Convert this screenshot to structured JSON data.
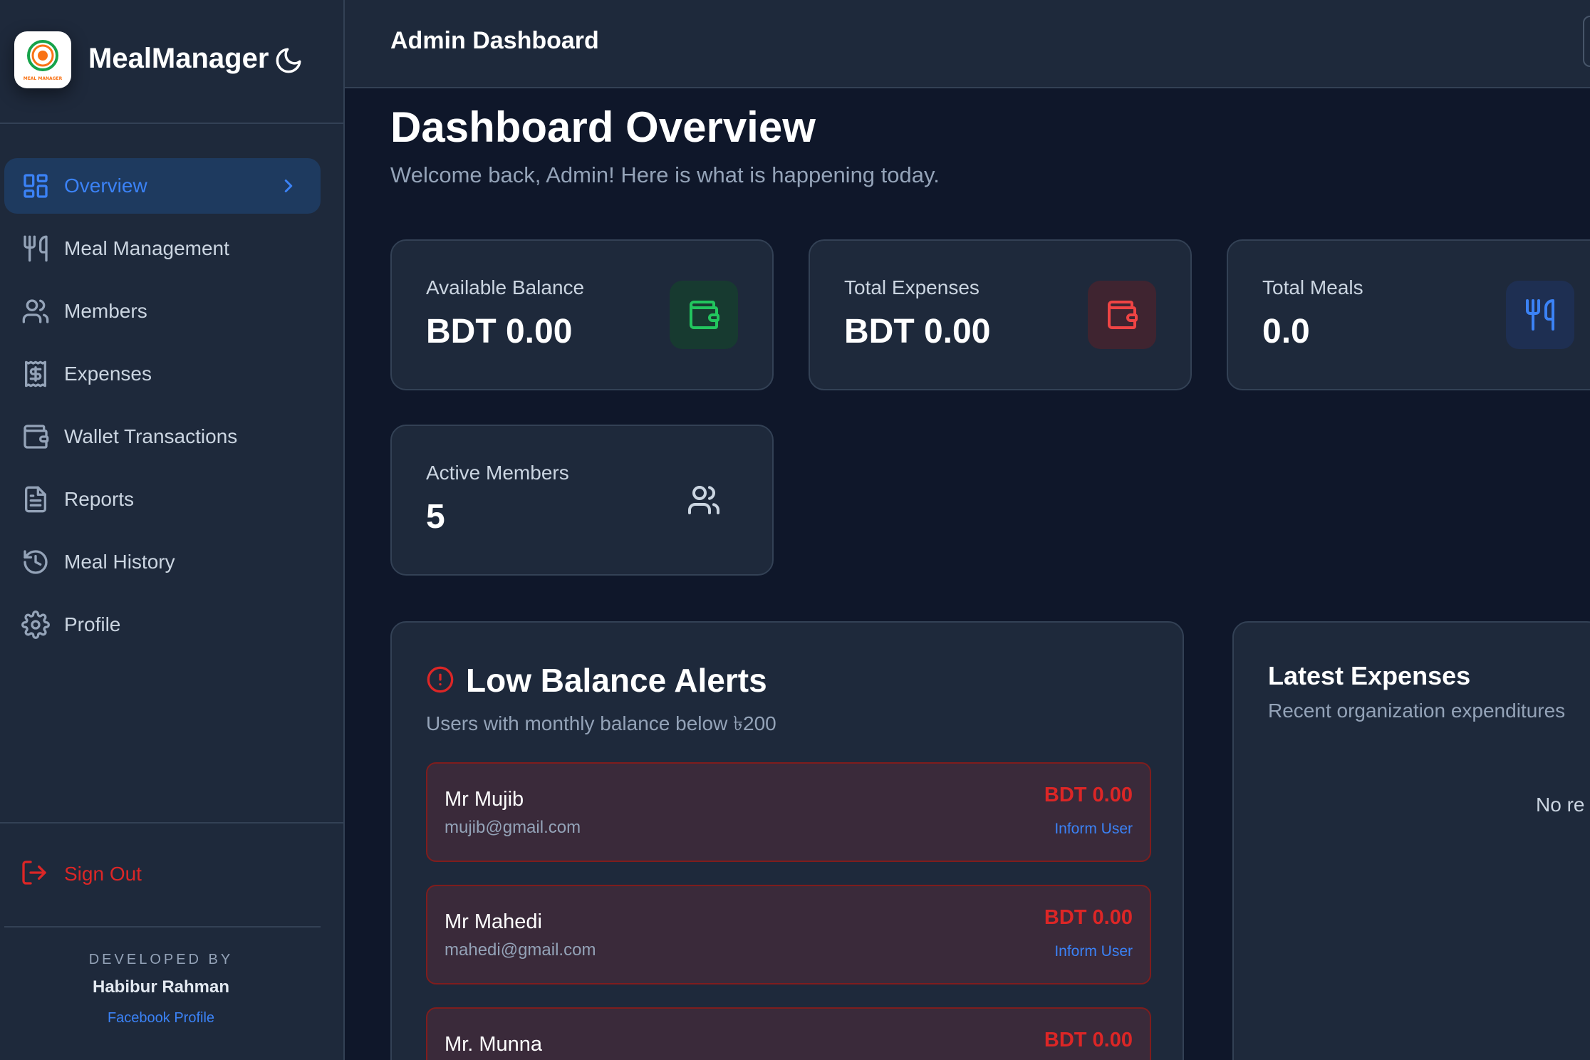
{
  "brand": {
    "name": "MealManager",
    "logo_text": "MEAL MANAGER"
  },
  "sidebar": {
    "items": [
      {
        "label": "Overview",
        "icon": "grid-icon"
      },
      {
        "label": "Meal Management",
        "icon": "utensils-icon"
      },
      {
        "label": "Members",
        "icon": "users-icon"
      },
      {
        "label": "Expenses",
        "icon": "receipt-icon"
      },
      {
        "label": "Wallet Transactions",
        "icon": "wallet-icon"
      },
      {
        "label": "Reports",
        "icon": "file-text-icon"
      },
      {
        "label": "Meal History",
        "icon": "history-icon"
      },
      {
        "label": "Profile",
        "icon": "settings-icon"
      }
    ],
    "sign_out": "Sign Out",
    "developed_by": "DEVELOPED BY",
    "developer": "Habibur Rahman",
    "developer_link": "Facebook Profile"
  },
  "header": {
    "title": "Admin Dashboard"
  },
  "main": {
    "title": "Dashboard Overview",
    "subtitle": "Welcome back, Admin! Here is what is happening today.",
    "stats": [
      {
        "label": "Available Balance",
        "value": "BDT 0.00",
        "icon": "wallet-icon",
        "color": "#22c55e"
      },
      {
        "label": "Total Expenses",
        "value": "BDT 0.00",
        "icon": "wallet-icon",
        "color": "#ef4444"
      },
      {
        "label": "Total Meals",
        "value": "0.0",
        "icon": "utensils-icon",
        "color": "#3b82f6"
      },
      {
        "label": "Active Members",
        "value": "5",
        "icon": "users-icon",
        "color": "#cbd5e1"
      }
    ],
    "low_balance": {
      "title": "Low Balance Alerts",
      "subtitle": "Users with monthly balance below ৳200",
      "users": [
        {
          "name": "Mr Mujib",
          "email": "mujib@gmail.com",
          "amount": "BDT 0.00",
          "action": "Inform User"
        },
        {
          "name": "Mr Mahedi",
          "email": "mahedi@gmail.com",
          "amount": "BDT 0.00",
          "action": "Inform User"
        },
        {
          "name": "Mr. Munna",
          "email": "",
          "amount": "BDT 0.00",
          "action": ""
        }
      ]
    },
    "latest_expenses": {
      "title": "Latest Expenses",
      "subtitle": "Recent organization expenditures",
      "empty_text": "No re"
    }
  },
  "colors": {
    "accent": "#3b82f6",
    "danger": "#dc2626",
    "success": "#22c55e",
    "bg": "#0f172a",
    "surface": "#1e293b"
  }
}
